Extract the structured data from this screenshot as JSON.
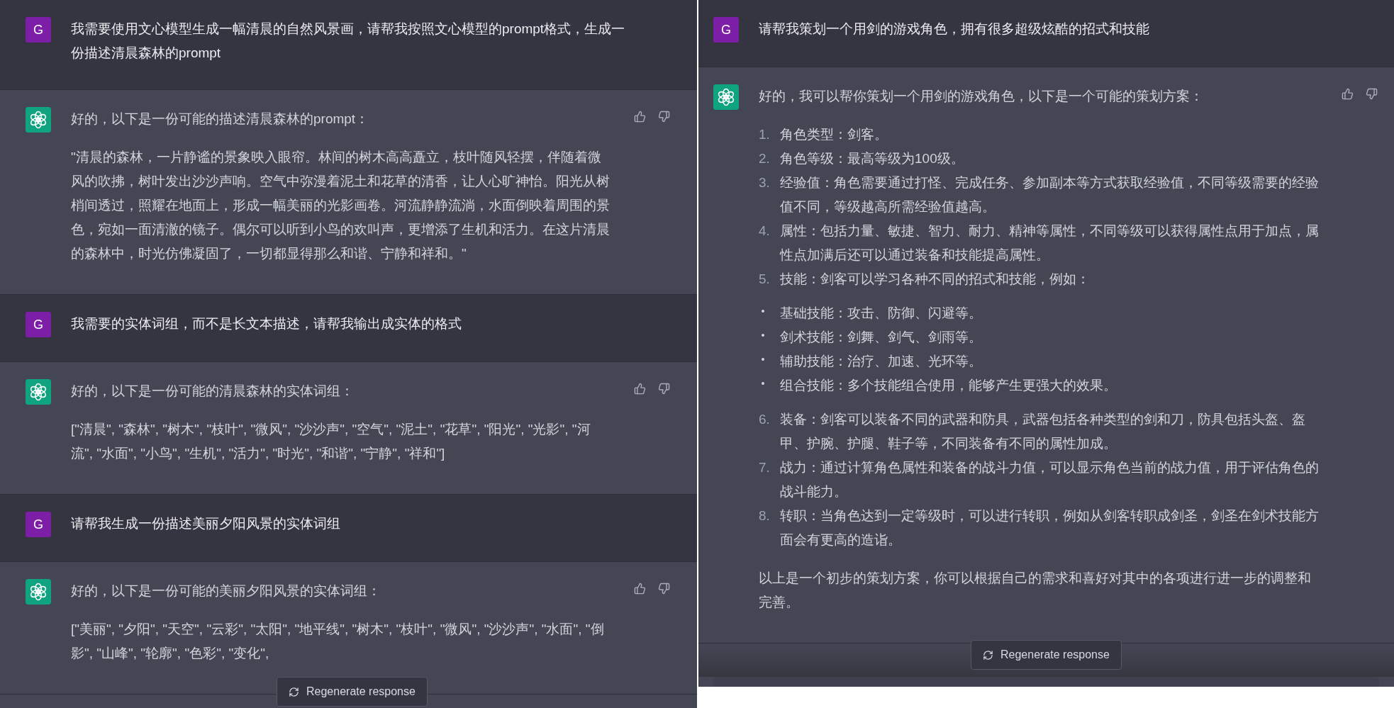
{
  "panels": [
    {
      "messages": [
        {
          "kind": "user",
          "avatar": "G",
          "text": "我需要使用文心模型生成一幅清晨的自然风景画，请帮我按照文心模型的prompt格式，生成一份描述清晨森林的prompt"
        },
        {
          "kind": "assistant",
          "blocks": [
            {
              "kind": "paragraph",
              "text": "好的，以下是一份可能的描述清晨森林的prompt："
            },
            {
              "kind": "paragraph",
              "text": "\"清晨的森林，一片静谧的景象映入眼帘。林间的树木高高矗立，枝叶随风轻摆，伴随着微风的吹拂，树叶发出沙沙声响。空气中弥漫着泥土和花草的清香，让人心旷神怡。阳光从树梢间透过，照耀在地面上，形成一幅美丽的光影画卷。河流静静流淌，水面倒映着周围的景色，宛如一面清澈的镜子。偶尔可以听到小鸟的欢叫声，更增添了生机和活力。在这片清晨的森林中，时光仿佛凝固了，一切都显得那么和谐、宁静和祥和。\""
            }
          ]
        },
        {
          "kind": "user",
          "avatar": "G",
          "text": "我需要的实体词组，而不是长文本描述，请帮我输出成实体的格式"
        },
        {
          "kind": "assistant",
          "blocks": [
            {
              "kind": "paragraph",
              "text": "好的，以下是一份可能的清晨森林的实体词组："
            },
            {
              "kind": "paragraph",
              "text": "[\"清晨\", \"森林\", \"树木\", \"枝叶\", \"微风\", \"沙沙声\", \"空气\", \"泥土\", \"花草\", \"阳光\", \"光影\", \"河流\", \"水面\", \"小鸟\", \"生机\", \"活力\", \"时光\", \"和谐\", \"宁静\", \"祥和\"]"
            }
          ]
        },
        {
          "kind": "user",
          "avatar": "G",
          "text": "请帮我生成一份描述美丽夕阳风景的实体词组"
        },
        {
          "kind": "assistant",
          "blocks": [
            {
              "kind": "paragraph",
              "text": "好的，以下是一份可能的美丽夕阳风景的实体词组："
            },
            {
              "kind": "paragraph",
              "text": "[\"美丽\", \"夕阳\", \"天空\", \"云彩\", \"太阳\", \"地平线\", \"树木\", \"枝叶\", \"微风\", \"沙沙声\", \"水面\", \"倒影\", \"山峰\", \"轮廓\", \"色彩\", \"变化\","
            }
          ]
        }
      ],
      "regenerate_button": "Regenerate response",
      "input_visible": false
    },
    {
      "messages": [
        {
          "kind": "user",
          "avatar": "G",
          "text": "请帮我策划一个用剑的游戏角色，拥有很多超级炫酷的招式和技能"
        },
        {
          "kind": "assistant",
          "blocks": [
            {
              "kind": "paragraph",
              "text": "好的，我可以帮你策划一个用剑的游戏角色，以下是一个可能的策划方案："
            },
            {
              "kind": "ordered",
              "items": [
                {
                  "number": "1.",
                  "text": "角色类型：剑客。"
                },
                {
                  "number": "2.",
                  "text": "角色等级：最高等级为100级。"
                },
                {
                  "number": "3.",
                  "text": "经验值：角色需要通过打怪、完成任务、参加副本等方式获取经验值，不同等级需要的经验值不同，等级越高所需经验值越高。"
                },
                {
                  "number": "4.",
                  "text": "属性：包括力量、敏捷、智力、耐力、精神等属性，不同等级可以获得属性点用于加点，属性点加满后还可以通过装备和技能提高属性。"
                },
                {
                  "number": "5.",
                  "text": "技能：剑客可以学习各种不同的招式和技能，例如：",
                  "children": [
                    {
                      "text": "基础技能：攻击、防御、闪避等。"
                    },
                    {
                      "text": "剑术技能：剑舞、剑气、剑雨等。"
                    },
                    {
                      "text": "辅助技能：治疗、加速、光环等。"
                    },
                    {
                      "text": "组合技能：多个技能组合使用，能够产生更强大的效果。"
                    }
                  ]
                },
                {
                  "number": "6.",
                  "text": "装备：剑客可以装备不同的武器和防具，武器包括各种类型的剑和刀，防具包括头盔、盔甲、护腕、护腿、鞋子等，不同装备有不同的属性加成。"
                },
                {
                  "number": "7.",
                  "text": "战力：通过计算角色属性和装备的战斗力值，可以显示角色当前的战力值，用于评估角色的战斗能力。"
                },
                {
                  "number": "8.",
                  "text": "转职：当角色达到一定等级时，可以进行转职，例如从剑客转职成剑圣，剑圣在剑术技能方面会有更高的造诣。"
                }
              ]
            },
            {
              "kind": "paragraph",
              "text": "以上是一个初步的策划方案，你可以根据自己的需求和喜好对其中的各项进行进一步的调整和完善。"
            }
          ]
        }
      ],
      "regenerate_button": "Regenerate response",
      "input_visible": true
    }
  ]
}
